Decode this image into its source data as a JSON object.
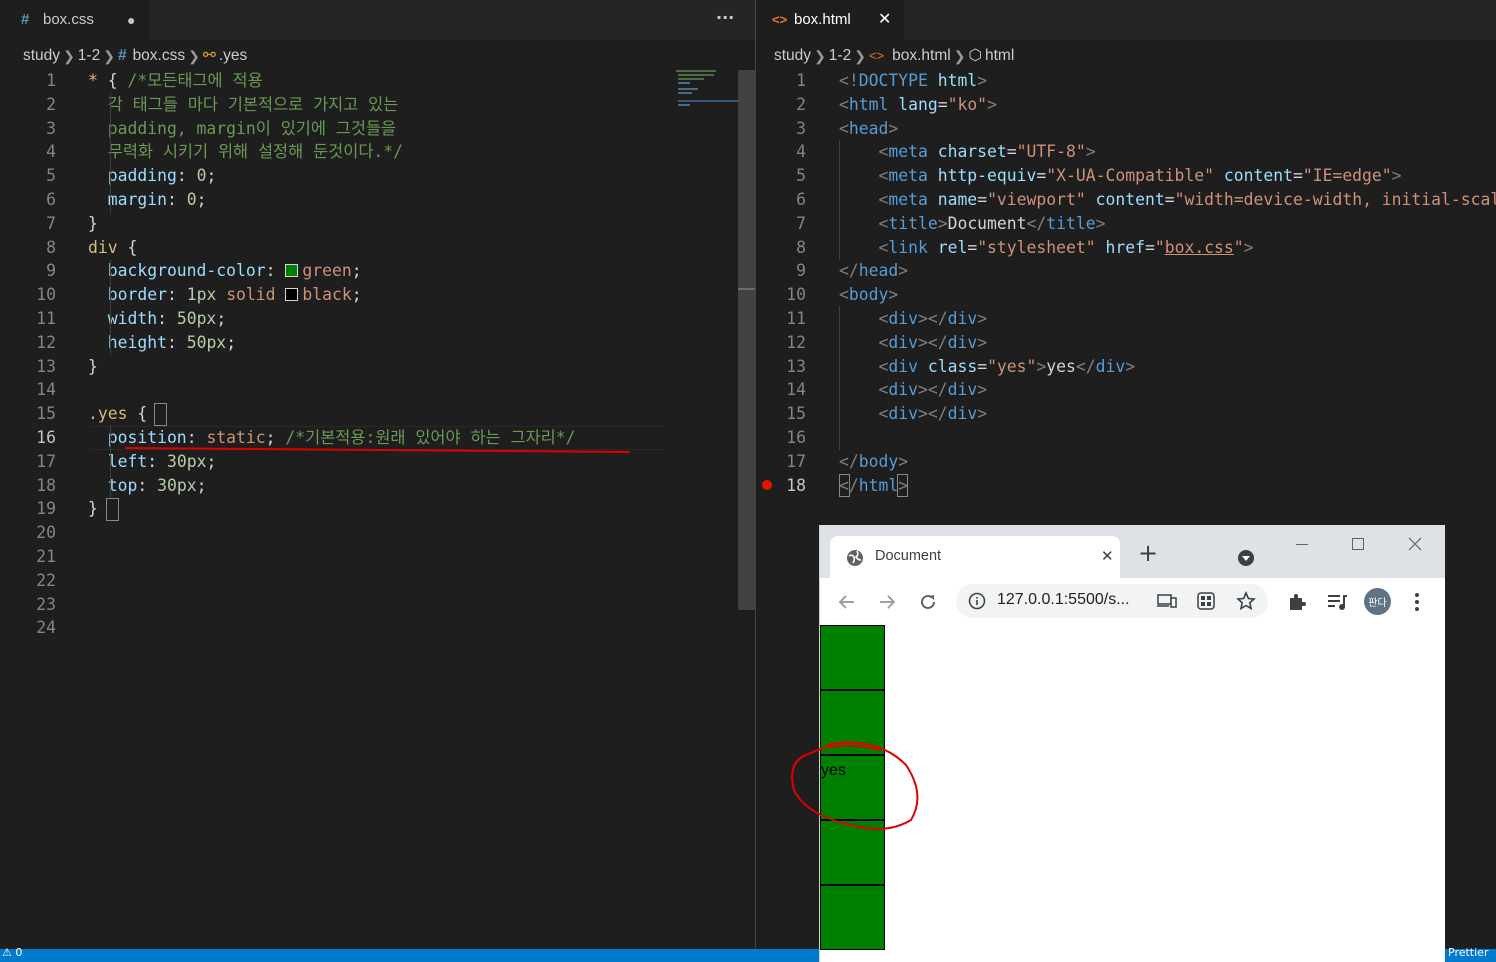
{
  "left_editor": {
    "tab": {
      "icon": "#",
      "label": "box.css",
      "dirty_dot": "●"
    },
    "more_actions": "···",
    "breadcrumb": [
      "study",
      "1-2",
      "#",
      "box.css",
      ".yes"
    ],
    "lines": [
      {
        "n": "1",
        "t": [
          [
            "c-sel",
            "* "
          ],
          [
            "c-wht",
            "{ "
          ],
          [
            "c-com",
            "/*모든태그에 적용"
          ]
        ]
      },
      {
        "n": "2",
        "t": [
          [
            "c-com",
            "  각 태그들 마다 기본적으로 가지고 있는"
          ]
        ]
      },
      {
        "n": "3",
        "t": [
          [
            "c-com",
            "  padding, margin이 있기에 그것들을"
          ]
        ]
      },
      {
        "n": "4",
        "t": [
          [
            "c-com",
            "  무력화 시키기 위해 설정해 둔것이다.*/"
          ]
        ]
      },
      {
        "n": "5",
        "t": [
          [
            "c-prop",
            "  padding"
          ],
          [
            "c-wht",
            ": "
          ],
          [
            "c-num",
            "0"
          ],
          [
            "c-wht",
            ";"
          ]
        ]
      },
      {
        "n": "6",
        "t": [
          [
            "c-prop",
            "  margin"
          ],
          [
            "c-wht",
            ": "
          ],
          [
            "c-num",
            "0"
          ],
          [
            "c-wht",
            ";"
          ]
        ]
      },
      {
        "n": "7",
        "t": [
          [
            "c-wht",
            "}"
          ]
        ]
      },
      {
        "n": "8",
        "t": [
          [
            "c-sel",
            "div "
          ],
          [
            "c-wht",
            "{"
          ]
        ]
      },
      {
        "n": "9",
        "t": [
          [
            "c-prop",
            "  background-color"
          ],
          [
            "c-wht",
            ": "
          ],
          [
            "swatch",
            "#008000"
          ],
          [
            "c-str",
            "green"
          ],
          [
            "c-wht",
            ";"
          ]
        ]
      },
      {
        "n": "10",
        "t": [
          [
            "c-prop",
            "  border"
          ],
          [
            "c-wht",
            ": "
          ],
          [
            "c-num",
            "1px "
          ],
          [
            "c-str",
            "solid "
          ],
          [
            "swatch",
            "#000000"
          ],
          [
            "c-str",
            "black"
          ],
          [
            "c-wht",
            ";"
          ]
        ]
      },
      {
        "n": "11",
        "t": [
          [
            "c-prop",
            "  width"
          ],
          [
            "c-wht",
            ": "
          ],
          [
            "c-num",
            "50px"
          ],
          [
            "c-wht",
            ";"
          ]
        ]
      },
      {
        "n": "12",
        "t": [
          [
            "c-prop",
            "  height"
          ],
          [
            "c-wht",
            ": "
          ],
          [
            "c-num",
            "50px"
          ],
          [
            "c-wht",
            ";"
          ]
        ]
      },
      {
        "n": "13",
        "t": [
          [
            "c-wht",
            "}"
          ]
        ]
      },
      {
        "n": "14",
        "t": []
      },
      {
        "n": "15",
        "t": [
          [
            "c-sel",
            ".yes "
          ],
          [
            "c-wht",
            "{"
          ]
        ]
      },
      {
        "n": "16",
        "t": [
          [
            "c-prop",
            "  position"
          ],
          [
            "c-wht",
            ": "
          ],
          [
            "c-str",
            "static"
          ],
          [
            "c-wht",
            "; "
          ],
          [
            "c-com",
            "/*기본적용:원래 있어야 하는 그자리*/"
          ]
        ]
      },
      {
        "n": "17",
        "t": [
          [
            "c-prop",
            "  left"
          ],
          [
            "c-wht",
            ": "
          ],
          [
            "c-num",
            "30px"
          ],
          [
            "c-wht",
            ";"
          ]
        ]
      },
      {
        "n": "18",
        "t": [
          [
            "c-prop",
            "  top"
          ],
          [
            "c-wht",
            ": "
          ],
          [
            "c-num",
            "30px"
          ],
          [
            "c-wht",
            ";"
          ]
        ]
      },
      {
        "n": "19",
        "t": [
          [
            "c-wht",
            "}"
          ]
        ]
      },
      {
        "n": "20",
        "t": []
      },
      {
        "n": "21",
        "t": []
      },
      {
        "n": "22",
        "t": []
      },
      {
        "n": "23",
        "t": []
      },
      {
        "n": "24",
        "t": []
      }
    ],
    "active_line": "16"
  },
  "right_editor": {
    "tab": {
      "icon": "<>",
      "label": "box.html",
      "close": "✕"
    },
    "breadcrumb": [
      "study",
      "1-2",
      "<>",
      "box.html",
      "html"
    ],
    "lines": [
      {
        "n": "1",
        "t": [
          [
            "c-punc",
            "<!"
          ],
          [
            "c-tag",
            "DOCTYPE "
          ],
          [
            "c-attr",
            "html"
          ],
          [
            "c-punc",
            ">"
          ]
        ]
      },
      {
        "n": "2",
        "t": [
          [
            "c-punc",
            "<"
          ],
          [
            "c-tag",
            "html "
          ],
          [
            "c-attr",
            "lang"
          ],
          [
            "c-wht",
            "="
          ],
          [
            "c-str",
            "\"ko\""
          ],
          [
            "c-punc",
            ">"
          ]
        ]
      },
      {
        "n": "3",
        "t": [
          [
            "c-punc",
            "<"
          ],
          [
            "c-tag",
            "head"
          ],
          [
            "c-punc",
            ">"
          ]
        ]
      },
      {
        "n": "4",
        "t": [
          [
            "c-wht",
            "    "
          ],
          [
            "c-punc",
            "<"
          ],
          [
            "c-tag",
            "meta "
          ],
          [
            "c-attr",
            "charset"
          ],
          [
            "c-wht",
            "="
          ],
          [
            "c-str",
            "\"UTF-8\""
          ],
          [
            "c-punc",
            ">"
          ]
        ]
      },
      {
        "n": "5",
        "t": [
          [
            "c-wht",
            "    "
          ],
          [
            "c-punc",
            "<"
          ],
          [
            "c-tag",
            "meta "
          ],
          [
            "c-attr",
            "http-equiv"
          ],
          [
            "c-wht",
            "="
          ],
          [
            "c-str",
            "\"X-UA-Compatible\" "
          ],
          [
            "c-attr",
            "content"
          ],
          [
            "c-wht",
            "="
          ],
          [
            "c-str",
            "\"IE=edge\""
          ],
          [
            "c-punc",
            ">"
          ]
        ]
      },
      {
        "n": "6",
        "t": [
          [
            "c-wht",
            "    "
          ],
          [
            "c-punc",
            "<"
          ],
          [
            "c-tag",
            "meta "
          ],
          [
            "c-attr",
            "name"
          ],
          [
            "c-wht",
            "="
          ],
          [
            "c-str",
            "\"viewport\" "
          ],
          [
            "c-attr",
            "content"
          ],
          [
            "c-wht",
            "="
          ],
          [
            "c-str",
            "\"width=device-width, initial-scale"
          ]
        ]
      },
      {
        "n": "7",
        "t": [
          [
            "c-wht",
            "    "
          ],
          [
            "c-punc",
            "<"
          ],
          [
            "c-tag",
            "title"
          ],
          [
            "c-punc",
            ">"
          ],
          [
            "c-wht",
            "Document"
          ],
          [
            "c-punc",
            "</"
          ],
          [
            "c-tag",
            "title"
          ],
          [
            "c-punc",
            ">"
          ]
        ]
      },
      {
        "n": "8",
        "t": [
          [
            "c-wht",
            "    "
          ],
          [
            "c-punc",
            "<"
          ],
          [
            "c-tag",
            "link "
          ],
          [
            "c-attr",
            "rel"
          ],
          [
            "c-wht",
            "="
          ],
          [
            "c-str",
            "\"stylesheet\" "
          ],
          [
            "c-attr",
            "href"
          ],
          [
            "c-wht",
            "="
          ],
          [
            "c-str",
            "\""
          ],
          [
            "c-link",
            "box.css"
          ],
          [
            "c-str",
            "\""
          ],
          [
            "c-punc",
            ">"
          ]
        ]
      },
      {
        "n": "9",
        "t": [
          [
            "c-punc",
            "</"
          ],
          [
            "c-tag",
            "head"
          ],
          [
            "c-punc",
            ">"
          ]
        ]
      },
      {
        "n": "10",
        "t": [
          [
            "c-punc",
            "<"
          ],
          [
            "c-tag",
            "body"
          ],
          [
            "c-punc",
            ">"
          ]
        ]
      },
      {
        "n": "11",
        "t": [
          [
            "c-wht",
            "    "
          ],
          [
            "c-punc",
            "<"
          ],
          [
            "c-tag",
            "div"
          ],
          [
            "c-punc",
            "></"
          ],
          [
            "c-tag",
            "div"
          ],
          [
            "c-punc",
            ">"
          ]
        ]
      },
      {
        "n": "12",
        "t": [
          [
            "c-wht",
            "    "
          ],
          [
            "c-punc",
            "<"
          ],
          [
            "c-tag",
            "div"
          ],
          [
            "c-punc",
            "></"
          ],
          [
            "c-tag",
            "div"
          ],
          [
            "c-punc",
            ">"
          ]
        ]
      },
      {
        "n": "13",
        "t": [
          [
            "c-wht",
            "    "
          ],
          [
            "c-punc",
            "<"
          ],
          [
            "c-tag",
            "div "
          ],
          [
            "c-attr",
            "class"
          ],
          [
            "c-wht",
            "="
          ],
          [
            "c-str",
            "\"yes\""
          ],
          [
            "c-punc",
            ">"
          ],
          [
            "c-wht",
            "yes"
          ],
          [
            "c-punc",
            "</"
          ],
          [
            "c-tag",
            "div"
          ],
          [
            "c-punc",
            ">"
          ]
        ]
      },
      {
        "n": "14",
        "t": [
          [
            "c-wht",
            "    "
          ],
          [
            "c-punc",
            "<"
          ],
          [
            "c-tag",
            "div"
          ],
          [
            "c-punc",
            "></"
          ],
          [
            "c-tag",
            "div"
          ],
          [
            "c-punc",
            ">"
          ]
        ]
      },
      {
        "n": "15",
        "t": [
          [
            "c-wht",
            "    "
          ],
          [
            "c-punc",
            "<"
          ],
          [
            "c-tag",
            "div"
          ],
          [
            "c-punc",
            "></"
          ],
          [
            "c-tag",
            "div"
          ],
          [
            "c-punc",
            ">"
          ]
        ]
      },
      {
        "n": "16",
        "t": []
      },
      {
        "n": "17",
        "t": [
          [
            "c-punc",
            "</"
          ],
          [
            "c-tag",
            "body"
          ],
          [
            "c-punc",
            ">"
          ]
        ]
      },
      {
        "n": "18",
        "t": [
          [
            "c-punc",
            "</"
          ],
          [
            "c-tag",
            "html"
          ],
          [
            "c-punc",
            ">"
          ]
        ]
      }
    ],
    "active_line": "18",
    "breakpoint_line": "18"
  },
  "browser": {
    "tab_title": "Document",
    "tab_close": "✕",
    "new_tab": "+",
    "url": "127.0.0.1:5500/s...",
    "profile_label": "판다",
    "yes_text": "yes",
    "box_color": "#008000",
    "box_count": 5
  },
  "status": {
    "left_text": "⚠ 0",
    "right_text": "Prettier"
  },
  "colors": {
    "editor_bg": "#1e1e1e",
    "statusbar": "#007acc",
    "annotation_red": "#e00000"
  }
}
